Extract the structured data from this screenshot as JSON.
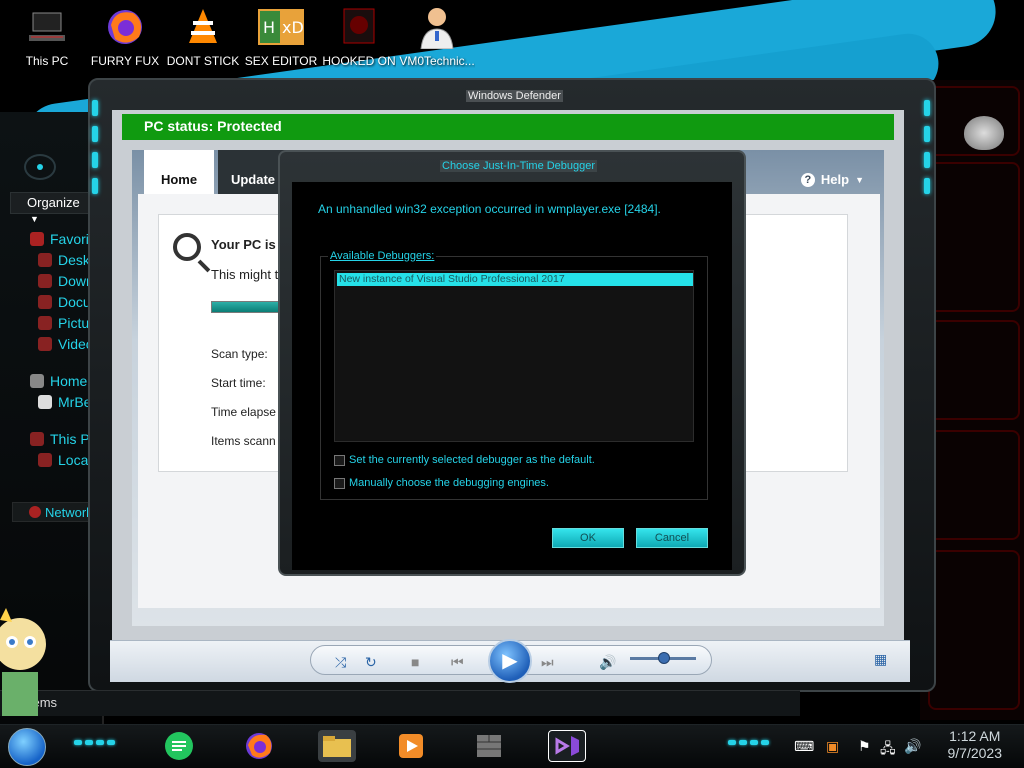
{
  "desktop": {
    "icons": [
      {
        "label": "This PC",
        "icon": "computer-icon"
      },
      {
        "label": "FURRY FUX",
        "icon": "firefox-icon"
      },
      {
        "label": "DONT STICK",
        "icon": "vlc-icon"
      },
      {
        "label": "SEX EDITOR",
        "icon": "hxd-icon"
      },
      {
        "label": "HOOKED ON",
        "icon": "video-icon"
      },
      {
        "label": "VM0Technic...",
        "icon": "doctor-icon"
      }
    ]
  },
  "explorer": {
    "organize_label": "Organize",
    "nav": [
      {
        "label": "Favorite",
        "level": 1,
        "color": "#d33"
      },
      {
        "label": "Deskt",
        "level": 2,
        "color": "#c44"
      },
      {
        "label": "Downl",
        "level": 2,
        "color": "#c44"
      },
      {
        "label": "Docur",
        "level": 2,
        "color": "#c44"
      },
      {
        "label": "Pictur",
        "level": 2,
        "color": "#c44"
      },
      {
        "label": "Video",
        "level": 2,
        "color": "#c44"
      },
      {
        "label": "Homegr",
        "level": 1,
        "color": "#999"
      },
      {
        "label": "MrBea",
        "level": 2,
        "color": "#ccc"
      },
      {
        "label": "This PC",
        "level": 1,
        "color": "#c44"
      },
      {
        "label": "Local",
        "level": 2,
        "color": "#c44"
      }
    ],
    "network_label": "Network",
    "items_label": "items"
  },
  "window": {
    "title": "Windows Defender"
  },
  "defender": {
    "status": "PC status: Protected",
    "tabs": [
      "Home",
      "Update"
    ],
    "help": "Help",
    "pc_line": "Your PC is b",
    "pc_sub": "This might t",
    "scan_rows": [
      "Scan type:",
      "Start time:",
      "Time elapse",
      "Items scann"
    ]
  },
  "dialog": {
    "title": "Choose Just-In-Time Debugger",
    "message": "An unhandled win32 exception occurred in wmplayer.exe [2484].",
    "available_label": "Available Debuggers:",
    "debuggers": [
      "New instance of Visual Studio Professional 2017"
    ],
    "check_default": "Set the currently selected debugger as the default.",
    "check_manual": "Manually choose the debugging engines.",
    "ok": "OK",
    "cancel": "Cancel"
  },
  "media": {
    "volume": 0.5
  },
  "taskbar": {
    "time": "1:12 AM",
    "date": "9/7/2023"
  },
  "colors": {
    "accent": "#25d3e8",
    "status_green": "#109a10",
    "alien_red": "#d10000"
  }
}
